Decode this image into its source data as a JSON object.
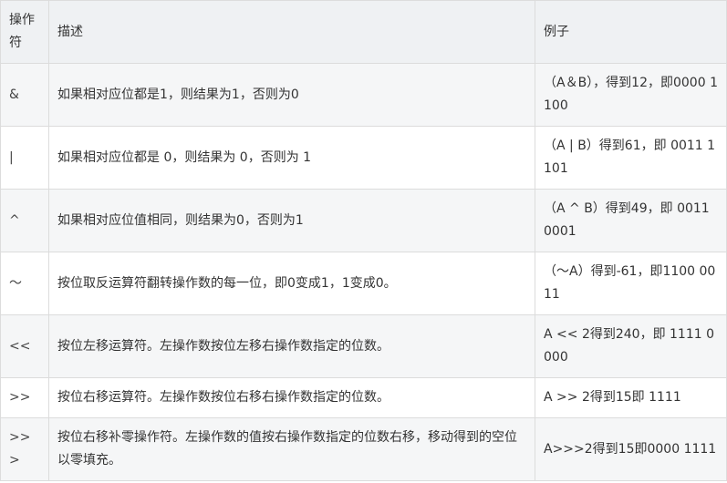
{
  "table": {
    "headers": {
      "operator": "操作符",
      "description": "描述",
      "example": "例子"
    },
    "rows": [
      {
        "operator": "&",
        "description": "如果相对应位都是1，则结果为1，否则为0",
        "example": "（A＆B），得到12，即0000 1100"
      },
      {
        "operator": "|",
        "description": "如果相对应位都是 0，则结果为 0，否则为 1",
        "example": "（A | B）得到61，即 0011 1101"
      },
      {
        "operator": "^",
        "description": "如果相对应位值相同，则结果为0，否则为1",
        "example": "（A ^ B）得到49，即 0011 0001"
      },
      {
        "operator": "〜",
        "description": "按位取反运算符翻转操作数的每一位，即0变成1，1变成0。",
        "example": "（〜A）得到-61，即1100 0011"
      },
      {
        "operator": "<<",
        "description": "按位左移运算符。左操作数按位左移右操作数指定的位数。",
        "example": "A << 2得到240，即 1111 0000"
      },
      {
        "operator": ">>",
        "description": "按位右移运算符。左操作数按位右移右操作数指定的位数。",
        "example": "A >> 2得到15即 1111"
      },
      {
        "operator": ">>>",
        "description": "按位右移补零操作符。左操作数的值按右操作数指定的位数右移，移动得到的空位以零填充。",
        "example": "A>>>2得到15即0000 1111"
      }
    ]
  }
}
